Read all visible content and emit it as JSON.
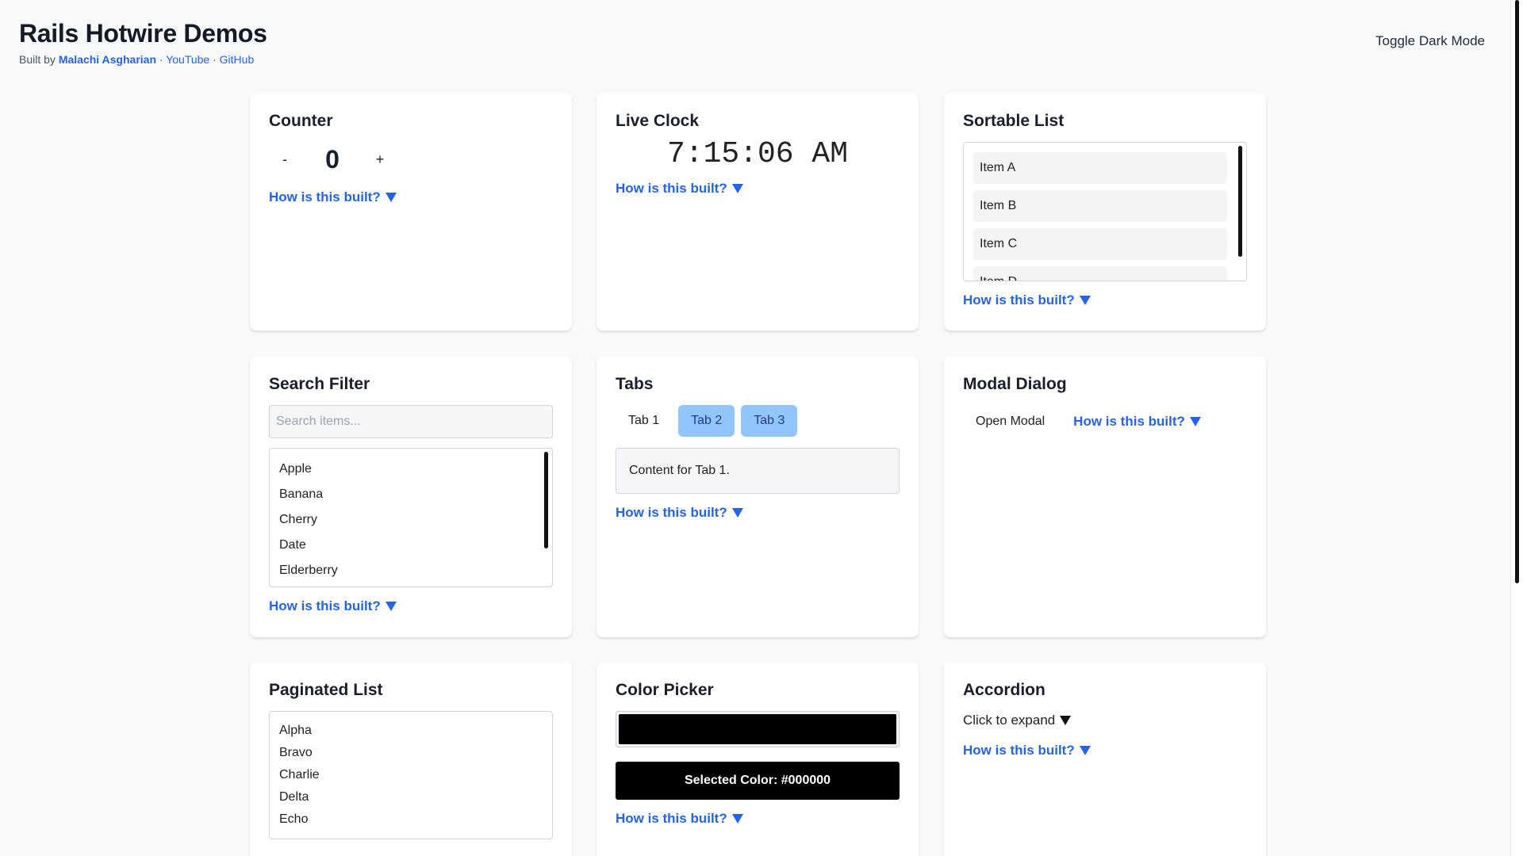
{
  "header": {
    "title": "Rails Hotwire Demos",
    "built_by": "Built by",
    "author": "Malachi Asgharian",
    "sep": "·",
    "youtube": "YouTube",
    "github": "GitHub",
    "toggle_dark": "Toggle Dark Mode"
  },
  "how_label": "How is this built?",
  "counter": {
    "title": "Counter",
    "minus": "-",
    "value": "0",
    "plus": "+"
  },
  "clock": {
    "title": "Live Clock",
    "time": "7:15:06 AM"
  },
  "sortable": {
    "title": "Sortable List",
    "items": [
      "Item A",
      "Item B",
      "Item C",
      "Item D"
    ]
  },
  "search": {
    "title": "Search Filter",
    "placeholder": "Search items...",
    "items": [
      "Apple",
      "Banana",
      "Cherry",
      "Date",
      "Elderberry"
    ]
  },
  "tabs": {
    "title": "Tabs",
    "labels": [
      "Tab 1",
      "Tab 2",
      "Tab 3"
    ],
    "content": "Content for Tab 1."
  },
  "modal": {
    "title": "Modal Dialog",
    "open": "Open Modal"
  },
  "paginated": {
    "title": "Paginated List",
    "items": [
      "Alpha",
      "Bravo",
      "Charlie",
      "Delta",
      "Echo"
    ]
  },
  "color_picker": {
    "title": "Color Picker",
    "value": "#000000",
    "selected_label": "Selected Color: #000000"
  },
  "accordion": {
    "title": "Accordion",
    "toggle": "Click to expand"
  },
  "colors": {
    "accent": "#2563eb",
    "tab_inactive": "#93c5fd",
    "card_bg": "#ffffff",
    "page_bg": "#f8f9fb"
  }
}
